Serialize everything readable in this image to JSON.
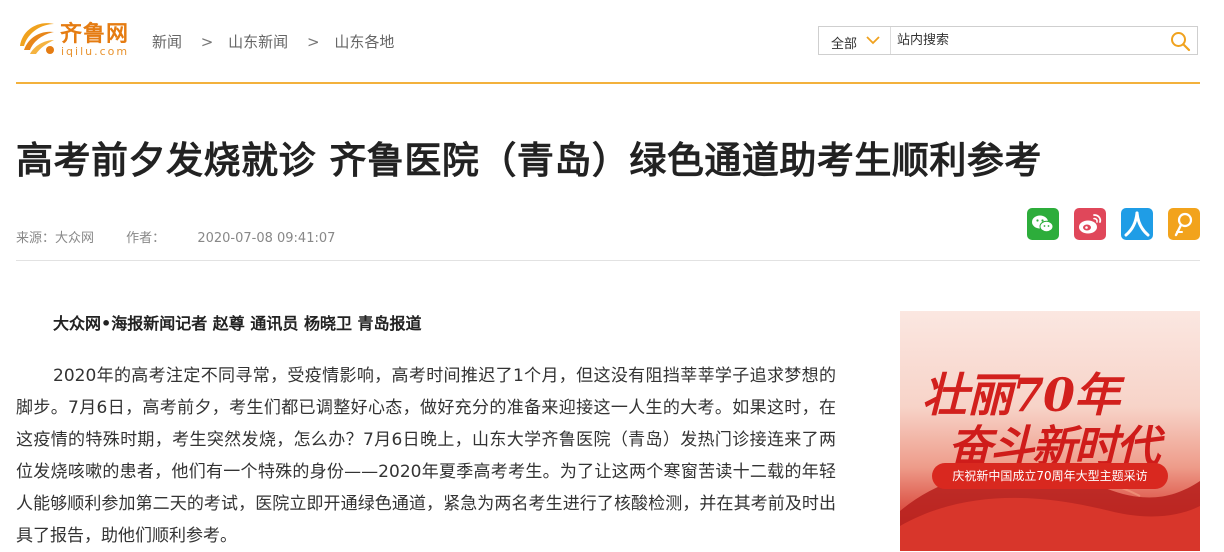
{
  "site": {
    "logo_cn": "齐鲁网",
    "logo_en": "iqilu.com",
    "brand_color": "#e57c12"
  },
  "breadcrumb": {
    "items": [
      "新闻",
      "山东新闻",
      "山东各地"
    ],
    "separator": ">"
  },
  "search": {
    "scope": "全部",
    "placeholder": "站内搜索",
    "value": ""
  },
  "article": {
    "title": "高考前夕发烧就诊 齐鲁医院（青岛）绿色通道助考生顺利参考",
    "source_label": "来源：大众网",
    "author_label": "作者：",
    "date": "2020-07-08 09:41:07",
    "byline": "大众网•海报新闻记者 赵尊 通讯员 杨晓卫 青岛报道",
    "paragraph": "2020年的高考注定不同寻常，受疫情影响，高考时间推迟了1个月，但这没有阻挡莘莘学子追求梦想的脚步。7月6日，高考前夕，考生们都已调整好心态，做好充分的准备来迎接这一人生的大考。如果这时，在这疫情的特殊时期，考生突然发烧，怎么办？7月6日晚上，山东大学齐鲁医院（青岛）发热门诊接连来了两位发烧咳嗽的患者，他们有一个特殊的身份——2020年夏季高考考生。为了让这两个寒窗苦读十二载的年轻人能够顺利参加第二天的考试，医院立即开通绿色通道，紧急为两名考生进行了核酸检测，并在其考前及时出具了报告，助他们顺利参考。"
  },
  "share": {
    "icons": [
      "wechat-icon",
      "weibo-icon",
      "renren-icon",
      "qzone-icon"
    ],
    "colors": [
      "#2dad3b",
      "#e0475a",
      "#1f9de6",
      "#f2a31c"
    ]
  },
  "banner": {
    "line1": "壮丽70年",
    "line2": "奋斗新时代",
    "caption": "庆祝新中国成立70周年大型主题采访"
  },
  "colors": {
    "accent_rule": "#f3b13c",
    "title": "#222222",
    "meta": "#888888"
  }
}
